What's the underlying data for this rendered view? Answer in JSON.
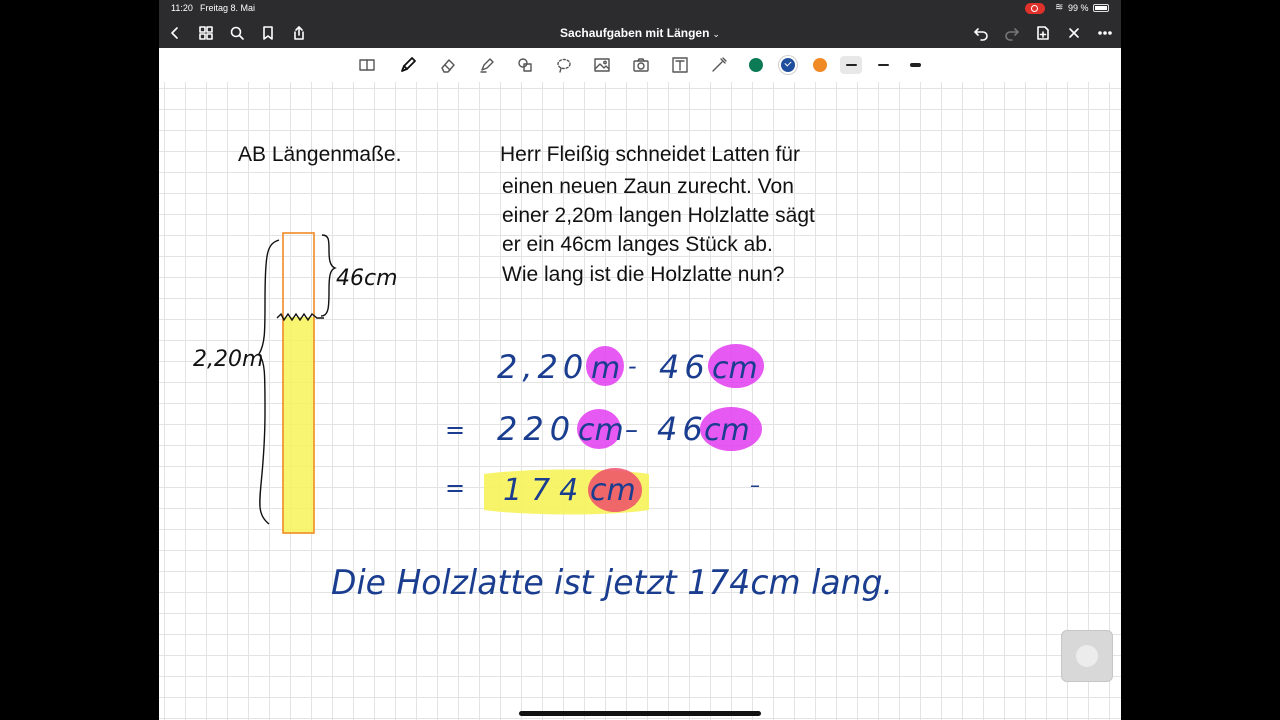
{
  "status_bar": {
    "time": "11:20",
    "date": "Freitag 8. Mai",
    "battery": "99 %"
  },
  "nav": {
    "title": "Sachaufgaben mit Längen",
    "chevron": "⌄"
  },
  "toolbar": {
    "colors": [
      "#0b7a55",
      "#1f4e9c",
      "#f08a24"
    ],
    "selected_color": "#1f4e9c"
  },
  "page": {
    "worksheet_title": "AB Längenmaße.",
    "problem_lines": [
      "Herr Fleißig schneidet Latten für",
      "einen neuen Zaun zurecht. Von",
      "einer 2,20m langen Holzlatte sägt",
      "er ein 46cm langes Stück ab.",
      "Wie lang ist die Holzlatte nun?"
    ],
    "sketch": {
      "top_label": "46cm",
      "left_label": "2,20m"
    },
    "calc": {
      "line1": {
        "number": "2,20",
        "unit1": "m",
        "op": "-",
        "number2": "46",
        "unit2": "cm"
      },
      "line2": {
        "eq": "=",
        "number": "220",
        "unit1": "cm",
        "op": "–",
        "number2": "46",
        "unit2": "cm"
      },
      "line3": {
        "eq": "=",
        "number": "174",
        "unit1": "cm",
        "dash": "–"
      }
    },
    "answer": "Die Holzlatte ist jetzt 174cm lang."
  },
  "ink_colors": {
    "pen": "#1a3d8f",
    "highlight_pink": "#e23cf0",
    "highlight_yellow": "#f7f35a",
    "highlight_red": "#ee4d6a",
    "board_orange": "#f08a24"
  }
}
